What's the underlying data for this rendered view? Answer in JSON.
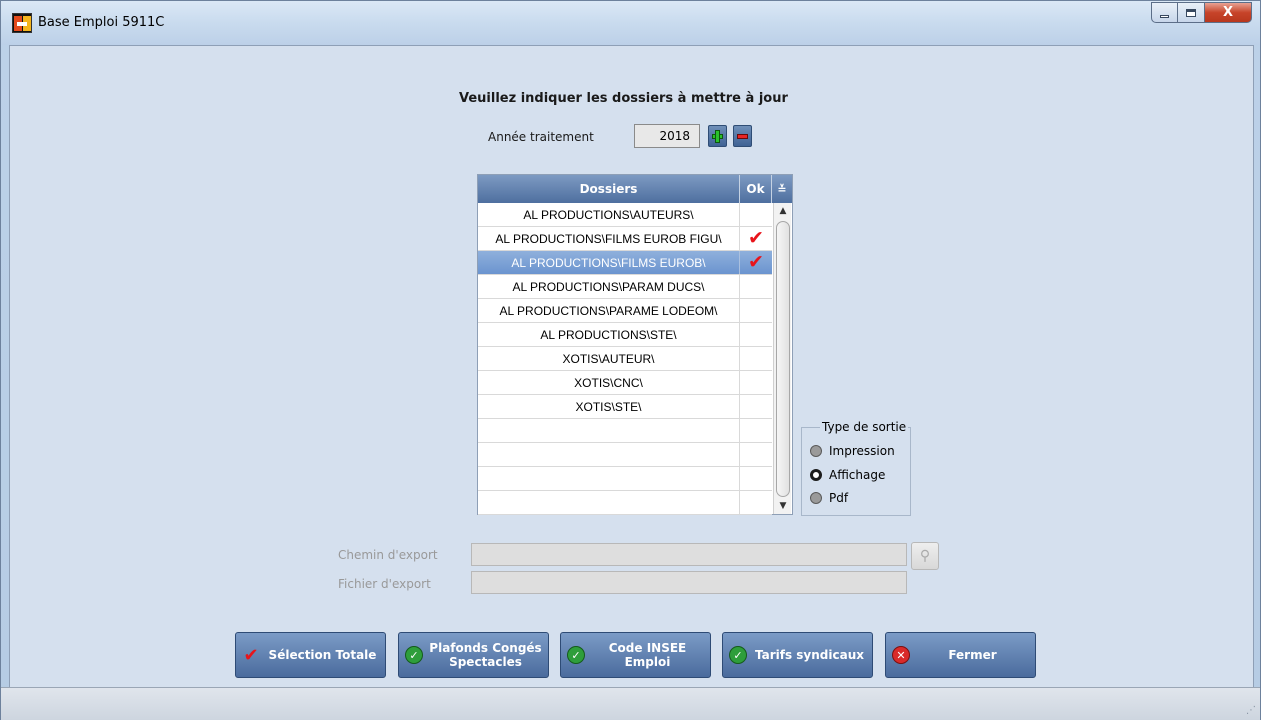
{
  "window": {
    "title": "Base Emploi 5911C",
    "close_glyph": "X"
  },
  "heading": "Veuillez indiquer les dossiers à mettre à jour",
  "year": {
    "label": "Année traitement",
    "value": "2018"
  },
  "grid": {
    "col_dossiers": "Dossiers",
    "col_ok": "Ok",
    "menu_glyph": "≚",
    "rows": [
      {
        "name": "AL PRODUCTIONS\\AUTEURS\\",
        "ok": "",
        "selected": false
      },
      {
        "name": "AL PRODUCTIONS\\FILMS EUROB FIGU\\",
        "ok": "✔",
        "selected": false
      },
      {
        "name": "AL PRODUCTIONS\\FILMS EUROB\\",
        "ok": "✔",
        "selected": true
      },
      {
        "name": "AL PRODUCTIONS\\PARAM DUCS\\",
        "ok": "",
        "selected": false
      },
      {
        "name": "AL PRODUCTIONS\\PARAME LODEOM\\",
        "ok": "",
        "selected": false
      },
      {
        "name": "AL PRODUCTIONS\\STE\\",
        "ok": "",
        "selected": false
      },
      {
        "name": "XOTIS\\AUTEUR\\",
        "ok": "",
        "selected": false
      },
      {
        "name": "XOTIS\\CNC\\",
        "ok": "",
        "selected": false
      },
      {
        "name": "XOTIS\\STE\\",
        "ok": "",
        "selected": false
      },
      {
        "name": "",
        "ok": "",
        "selected": false
      },
      {
        "name": "",
        "ok": "",
        "selected": false
      },
      {
        "name": "",
        "ok": "",
        "selected": false
      },
      {
        "name": "",
        "ok": "",
        "selected": false
      }
    ]
  },
  "output_type": {
    "legend": "Type de sortie",
    "options": [
      {
        "label": "Impression",
        "checked": false
      },
      {
        "label": "Affichage",
        "checked": true
      },
      {
        "label": "Pdf",
        "checked": false
      }
    ]
  },
  "export": {
    "path_label": "Chemin d'export",
    "path_value": "",
    "file_label": "Fichier d'export",
    "file_value": ""
  },
  "actions": {
    "select_all": "Sélection Totale",
    "plafonds_line1": "Plafonds Congés",
    "plafonds_line2": "Spectacles",
    "insee_line1": "Code INSEE",
    "insee_line2": "Emploi",
    "tarifs": "Tarifs syndicaux",
    "close": "Fermer"
  },
  "colors": {
    "accent": "#4e6f9f",
    "selection": "#6b94cf",
    "check": "#e8141b"
  }
}
